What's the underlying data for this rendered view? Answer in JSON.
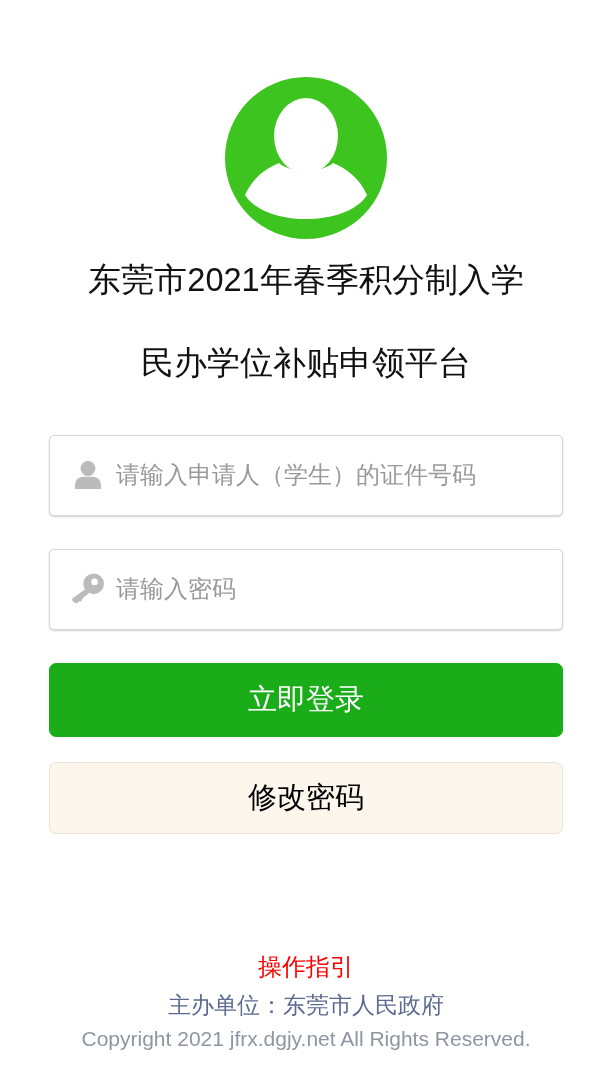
{
  "title_lines": [
    "东莞市2021年春季积分制入学",
    "民办学位补贴申领平台"
  ],
  "fields": [
    {
      "kind": "user",
      "placeholder": "请输入申请人（学生）的证件号码"
    },
    {
      "kind": "password",
      "placeholder": "请输入密码"
    }
  ],
  "buttons": [
    {
      "kind": "primary",
      "label": "立即登录"
    },
    {
      "kind": "secondary",
      "label": "修改密码"
    }
  ],
  "footer": {
    "guide_link": "操作指引",
    "organizer": "主办单位：东莞市人民政府",
    "copyright": "Copyright 2021 jfrx.dgjy.net All Rights Reserved."
  }
}
